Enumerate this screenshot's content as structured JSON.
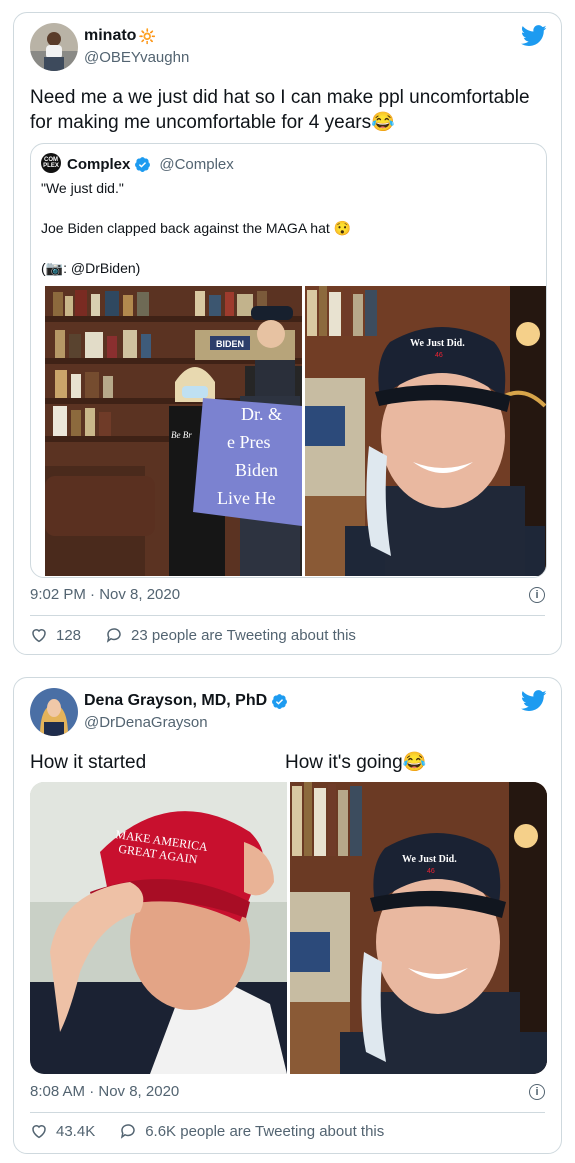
{
  "tweet1": {
    "name": "minato",
    "name_emoji": "🔆",
    "handle": "@OBEYvaughn",
    "text": "Need me a we just did hat so I can make ppl uncomfortable for making me uncomfortable for 4 years😂",
    "quote": {
      "name": "Complex",
      "handle": "@Complex",
      "logo": "COM PLEX",
      "line1": "\"We just did.\"",
      "line2": "Joe Biden clapped back against the MAGA hat 😯",
      "line3": "(📷: @DrBiden)",
      "sign_text": [
        "Dr. &",
        "e Pres",
        "Biden",
        "Live He"
      ],
      "sign_partial": "Be Br",
      "cap_text": "We Just Did.",
      "cap_small": "46",
      "bidden_sign": "BIDEN"
    },
    "timestamp": "9:02 PM · Nov 8, 2020",
    "likes": "128",
    "retweets_text": "23 people are Tweeting about this"
  },
  "tweet2": {
    "name": "Dena Grayson, MD, PhD",
    "handle": "@DrDenaGrayson",
    "label_left": "How it started",
    "label_right": "How it's going😂",
    "maga_hat_text": "MAKE AMERICA GREAT AGAIN",
    "cap_text": "We Just Did.",
    "cap_small": "46",
    "timestamp": "8:08 AM · Nov 8, 2020",
    "likes": "43.4K",
    "retweets_text": "6.6K people are Tweeting about this"
  },
  "colors": {
    "twitter_blue": "#1d9bf0",
    "secondary_text": "#536471",
    "border": "#cfd9de",
    "maga_red": "#c8102e",
    "cap_navy": "#1a2233"
  },
  "icons": [
    "twitter-bird-icon",
    "verified-badge-icon",
    "heart-icon",
    "chat-bubble-icon",
    "info-icon"
  ]
}
